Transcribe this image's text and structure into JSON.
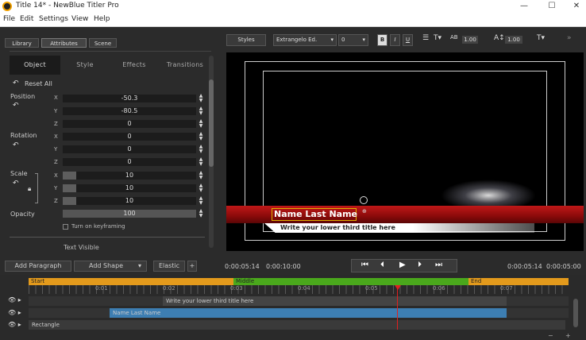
{
  "window": {
    "title": "Title 14* - NewBlue Titler Pro",
    "minimize": "—",
    "maximize": "☐",
    "close": "✕"
  },
  "menu": [
    "File",
    "Edit",
    "Settings",
    "View",
    "Help"
  ],
  "left_tabs": [
    "Library",
    "Attributes",
    "Scene"
  ],
  "sub_tabs": [
    "Object",
    "Style",
    "Effects",
    "Transitions"
  ],
  "reset_all": "Reset All",
  "position": {
    "label": "Position",
    "x": "-50.3",
    "y": "-80.5",
    "z": "0"
  },
  "rotation": {
    "label": "Rotation",
    "x": "0",
    "y": "0",
    "z": "0"
  },
  "scale": {
    "label": "Scale",
    "x": "10",
    "y": "10",
    "z": "10"
  },
  "opacity": {
    "label": "Opacity",
    "value": "100"
  },
  "axes": {
    "x": "X",
    "y": "Y",
    "z": "Z"
  },
  "keyframing": "Turn on keyframing",
  "text_visible_partial": "Text Visible",
  "toolbar": {
    "styles": "Styles",
    "font": "Extrangelo Ed.",
    "size": "0",
    "bold": "B",
    "italic": "I",
    "underline": "U",
    "spacing1": "1.00",
    "spacing2": "1.00"
  },
  "preview": {
    "headline": "Name Last Name",
    "subline": "Write your lower third title here"
  },
  "bottom_controls": {
    "add_paragraph": "Add Paragraph",
    "add_shape": "Add Shape",
    "elastic": "Elastic",
    "plus": "+",
    "time_current": "0:00:05:14",
    "time_total": "0:00:10:00",
    "time_right1": "0:00:05:14",
    "time_right2": "0:00:05:00"
  },
  "timeline": {
    "markers": {
      "start": "Start",
      "middle": "Middle",
      "end": "End"
    },
    "ruler": [
      "0:01",
      "0:02",
      "0:03",
      "0:04",
      "0:05",
      "0:06",
      "0:07"
    ],
    "tracks": [
      "Write your lower third title here",
      "Name Last Name",
      "Rectangle"
    ]
  },
  "colors": {
    "start_marker": "#e39a1c",
    "middle_marker": "#4aa81c",
    "end_marker": "#e39a1c",
    "red_bar": "#a01212",
    "track_blue": "#3d7eb2",
    "playhead": "#e02020"
  }
}
